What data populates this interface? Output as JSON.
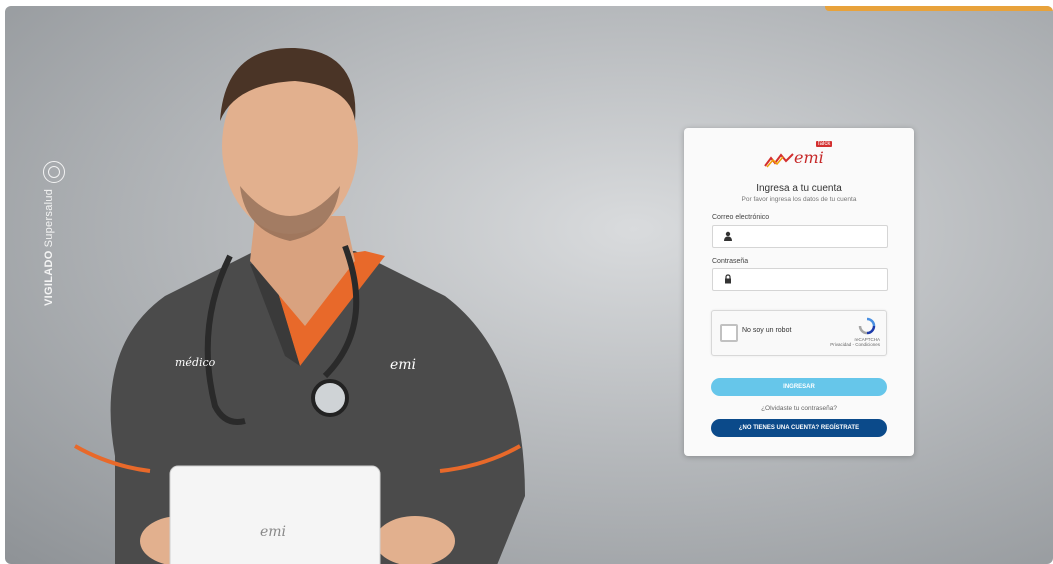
{
  "brand": {
    "name": "emi",
    "badge": "falck",
    "accent_color": "#e8a23b",
    "primary_color": "#66c6ea",
    "secondary_color": "#0b4a8a"
  },
  "side": {
    "vigilado_bold": "VIGILADO",
    "vigilado_text": "Supersalud"
  },
  "illustration": {
    "uniform_label": "médico",
    "uniform_brand": "emi",
    "tablet_brand": "emi"
  },
  "login": {
    "title": "Ingresa a tu cuenta",
    "subtitle": "Por favor ingresa los datos de tu cuenta",
    "email_label": "Correo electrónico",
    "email_value": "",
    "password_label": "Contraseña",
    "password_value": "",
    "captcha_label": "No soy un robot",
    "captcha_brand": "reCAPTCHA",
    "captcha_links": "Privacidad - Condiciones",
    "submit_label": "INGRESAR",
    "forgot_label": "¿Olvidaste tu contraseña?",
    "register_label": "¿NO TIENES UNA CUENTA? REGÍSTRATE"
  }
}
